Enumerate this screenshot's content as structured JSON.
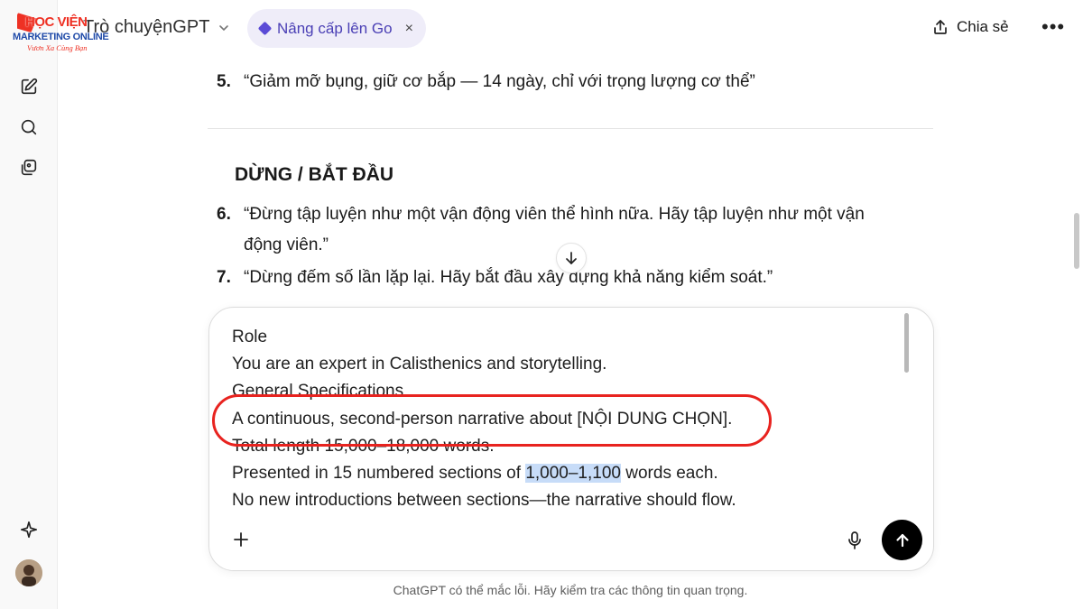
{
  "logo": {
    "line1": "HỌC VIỆN",
    "line2": "MARKETING ONLINE",
    "line3": "Vươn Xa Cùng Bạn"
  },
  "header": {
    "model_title": "Trò chuyệnGPT",
    "upgrade_label": "Nâng cấp lên Go",
    "upgrade_close": "×",
    "share_label": "Chia sẻ",
    "more_label": "•••"
  },
  "conversation": {
    "item5": {
      "num": "5.",
      "text": "“Giảm mỡ bụng, giữ cơ bắp — 14 ngày, chỉ với trọng lượng cơ thể”"
    },
    "heading": "DỪNG / BẮT ĐẦU",
    "item6": {
      "num": "6.",
      "text": "“Đừng tập luyện như một vận động viên thể hình nữa. Hãy tập luyện như một vận",
      "cont": "động viên.”"
    },
    "item7": {
      "num": "7.",
      "text": "“Dừng đếm số lần lặp lại. Hãy bắt đầu xây dựng khả năng kiểm soát.”"
    }
  },
  "composer": {
    "lines": {
      "l1": "Role",
      "l2": "You are an expert in Calisthenics and storytelling.",
      "l3": "General Specifications",
      "l4": "A continuous, second-person narrative about [NỘI DUNG CHỌN].",
      "l5": "Total length 15,000–18,000 words.",
      "l6_pre": "Presented in 15 numbered sections of ",
      "l6_sel": "1,000–1,100",
      "l6_post": " words each.",
      "l7": "No new introductions between sections—the narrative should flow."
    }
  },
  "disclaimer": "ChatGPT có thể mắc lỗi. Hãy kiểm tra các thông tin quan trọng.",
  "colors": {
    "accent_red": "#e8231f",
    "upgrade_bg": "#efedf9",
    "upgrade_text": "#4a3fb5",
    "selection": "#c7dcf8"
  },
  "icons": {
    "rail": [
      "new-chat-icon",
      "search-icon",
      "library-icon",
      "sparkle-icon"
    ],
    "header": [
      "chevron-down-icon",
      "diamond-icon",
      "share-icon",
      "more-icon"
    ],
    "composer": [
      "plus-icon",
      "mic-icon",
      "send-arrow-icon"
    ]
  }
}
